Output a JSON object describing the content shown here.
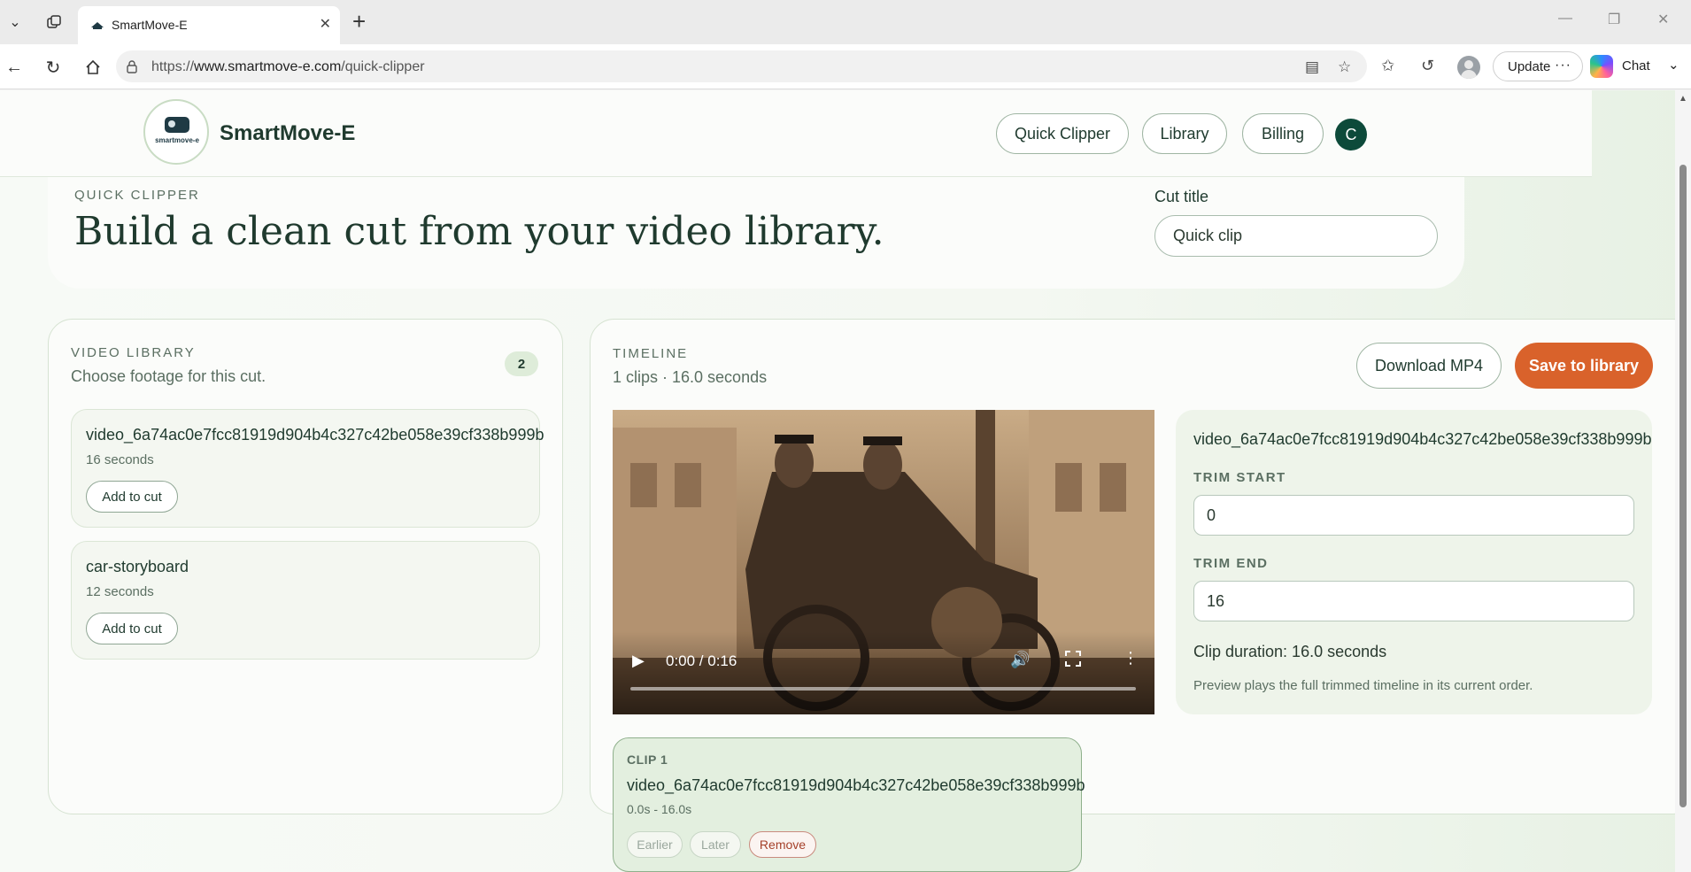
{
  "browser": {
    "tab_title": "SmartMove-E",
    "url_prefix": "https://",
    "url_host": "www.smartmove-e.com",
    "url_path": "/quick-clipper",
    "update_label": "Update",
    "chat_label": "Chat"
  },
  "header": {
    "logo_text": "smartmove-e",
    "brand": "SmartMove-E",
    "nav": [
      "Quick Clipper",
      "Library",
      "Billing"
    ],
    "avatar_initial": "C",
    "accent_color": "#0d4a3a"
  },
  "hero": {
    "eyebrow": "QUICK CLIPPER",
    "title": "Build a clean cut from your video library.",
    "cut_title_label": "Cut title",
    "cut_title_value": "Quick clip"
  },
  "library": {
    "eyebrow": "VIDEO LIBRARY",
    "subtitle": "Choose footage for this cut.",
    "count": "2",
    "items": [
      {
        "name": "video_6a74ac0e7fcc81919d904b4c327c42be058e39cf338b999b",
        "duration": "16 seconds",
        "action": "Add to cut"
      },
      {
        "name": "car-storyboard",
        "duration": "12 seconds",
        "action": "Add to cut"
      }
    ]
  },
  "timeline": {
    "eyebrow": "TIMELINE",
    "summary": "1 clips · 16.0 seconds",
    "download_label": "Download MP4",
    "save_label": "Save to library",
    "save_color": "#d9622b",
    "player": {
      "time": "0:00 / 0:16",
      "progress": 0
    },
    "trim": {
      "clip_name": "video_6a74ac0e7fcc81919d904b4c327c42be058e39cf338b999b",
      "start_label": "TRIM START",
      "start_value": "0",
      "end_label": "TRIM END",
      "end_value": "16",
      "duration_text": "Clip duration: 16.0 seconds",
      "note": "Preview plays the full trimmed timeline in its current order."
    },
    "clips": [
      {
        "label": "CLIP 1",
        "name": "video_6a74ac0e7fcc81919d904b4c327c42be058e39cf338b999b",
        "range": "0.0s - 16.0s",
        "earlier_label": "Earlier",
        "later_label": "Later",
        "remove_label": "Remove"
      }
    ]
  }
}
